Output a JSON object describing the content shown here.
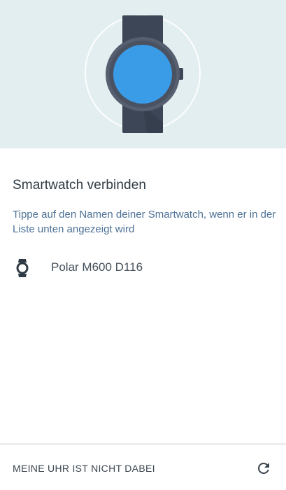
{
  "hero": {
    "illustration": "watch-illustration",
    "colors": {
      "background": "#e3eef0",
      "band": "#3c4656",
      "bezel": "#565f70",
      "face": "#3a9be6"
    }
  },
  "main": {
    "title": "Smartwatch verbinden",
    "subtitle": "Tippe auf den Namen deiner Smartwatch, wenn er in der Liste unten angezeigt wird",
    "devices": [
      {
        "icon": "watch-icon",
        "name": "Polar M600 D116"
      }
    ]
  },
  "footer": {
    "button_label": "MEINE UHR IST NICHT DABEI",
    "refresh_icon": "refresh-icon"
  }
}
